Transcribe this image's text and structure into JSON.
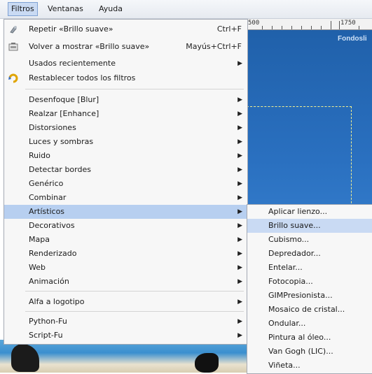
{
  "menubar": [
    {
      "label": "Filtros",
      "active": true
    },
    {
      "label": "Ventanas",
      "active": false
    },
    {
      "label": "Ayuda",
      "active": false
    }
  ],
  "ruler": {
    "label_left": "500",
    "label_right": "1750"
  },
  "watermark": "Fondosli",
  "filters_menu": {
    "repeat": {
      "label": "Repetir «Brillo suave»",
      "shortcut": "Ctrl+F",
      "icon": "repeat-icon"
    },
    "reshow": {
      "label": "Volver a mostrar «Brillo suave»",
      "shortcut": "Mayús+Ctrl+F",
      "icon": "reshow-icon"
    },
    "recent": {
      "label": "Usados recientemente"
    },
    "reset": {
      "label": "Restablecer todos los filtros",
      "icon": "reset-icon"
    },
    "items": [
      "Desenfoque [Blur]",
      "Realzar [Enhance]",
      "Distorsiones",
      "Luces y sombras",
      "Ruido",
      "Detectar bordes",
      "Genérico",
      "Combinar",
      "Artísticos",
      "Decorativos",
      "Mapa",
      "Renderizado",
      "Web",
      "Animación"
    ],
    "alpha": "Alfa a logotipo",
    "python": "Python-Fu",
    "script": "Script-Fu"
  },
  "artistic_submenu": [
    "Aplicar lienzo...",
    "Brillo suave...",
    "Cubismo...",
    "Depredador...",
    "Entelar...",
    "Fotocopia...",
    "GIMPresionista...",
    "Mosaico de cristal...",
    "Ondular...",
    "Pintura al óleo...",
    "Van Gogh (LIC)...",
    "Viñeta..."
  ],
  "colors": {
    "highlight": "#b7cff0",
    "menu_bg": "#f7f7f7",
    "canvas": "#2a70c0"
  }
}
